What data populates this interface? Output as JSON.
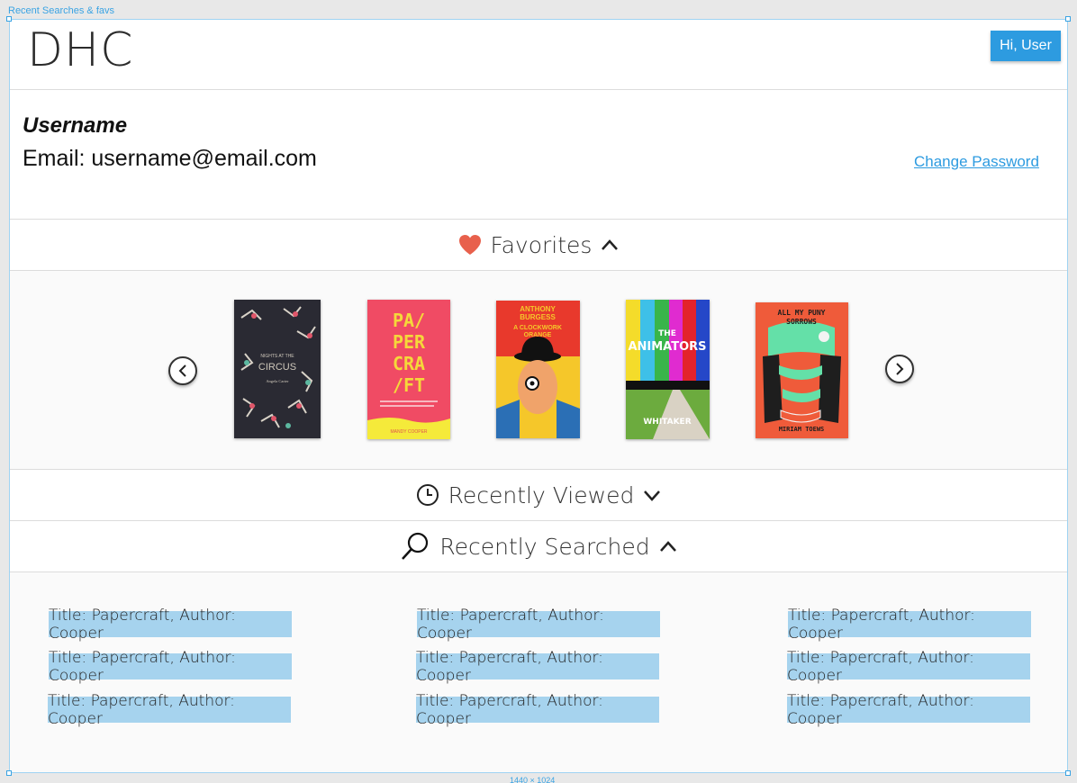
{
  "frame": {
    "label": "Recent Searches & favs",
    "dimensions": "1440 × 1024"
  },
  "header": {
    "logo": "DHC",
    "user_button": "Hi, User"
  },
  "profile": {
    "username": "Username",
    "email": "Email: username@email.com",
    "change_password": "Change Password"
  },
  "sections": {
    "favorites": "Favorites",
    "recently_viewed": "Recently Viewed",
    "recently_searched": "Recently Searched"
  },
  "favorites": {
    "books": [
      {
        "title": "NIGHTS AT THE",
        "title2": "CIRCUS",
        "author": "Angela Carter"
      },
      {
        "title": "PA/ PER CRA /FT",
        "author": "MANDY COOPER"
      },
      {
        "title": "A CLOCKWORK ORANGE",
        "author": "ANTHONY BURGESS"
      },
      {
        "title": "THE ANIMATORS",
        "author": "KAYLA RAE WHITAKER"
      },
      {
        "title": "ALL MY PUNY SORROWS",
        "author": "MIRIAM TOEWS"
      }
    ]
  },
  "recent_searches": [
    "Title: Papercraft, Author: Cooper",
    "Title: Papercraft, Author: Cooper",
    "Title: Papercraft, Author: Cooper",
    "Title: Papercraft, Author: Cooper",
    "Title: Papercraft, Author: Cooper",
    "Title: Papercraft, Author: Cooper",
    "Title: Papercraft, Author: Cooper",
    "Title: Papercraft, Author: Cooper",
    "Title: Papercraft, Author: Cooper"
  ],
  "colors": {
    "accent": "#2d9be0",
    "chip": "#a6d3ee",
    "heart": "#e8604c"
  }
}
